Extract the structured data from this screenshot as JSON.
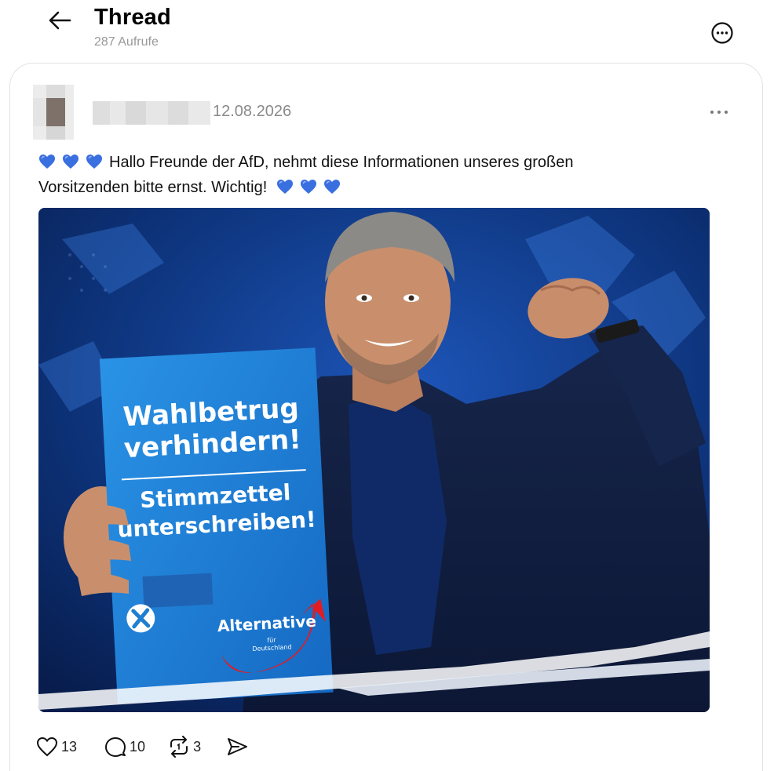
{
  "header": {
    "title": "Thread",
    "views": "287 Aufrufe",
    "back_icon": "arrow-left-icon",
    "more_icon": "more-circle-icon"
  },
  "post": {
    "date": "12.08.2026",
    "text_line1": "Hallo Freunde der AfD, nehmt diese Informationen unseres großen",
    "text_line2": "Vorsitzenden bitte ernst. Wichtig!",
    "emoji": "blue-heart",
    "heart_color": "#2f63d8",
    "image": {
      "headline1": "Wahlbetrug",
      "headline2": "verhindern!",
      "subline1": "Stimmzettel",
      "subline2": "unterschreiben!",
      "logo_text": "Alternative",
      "logo_subtext1": "für",
      "logo_subtext2": "Deutschland",
      "accent_color": "#e31b23",
      "flyer_color": "#1e7fd2"
    }
  },
  "actions": {
    "likes": "13",
    "replies": "10",
    "reposts": "3"
  }
}
